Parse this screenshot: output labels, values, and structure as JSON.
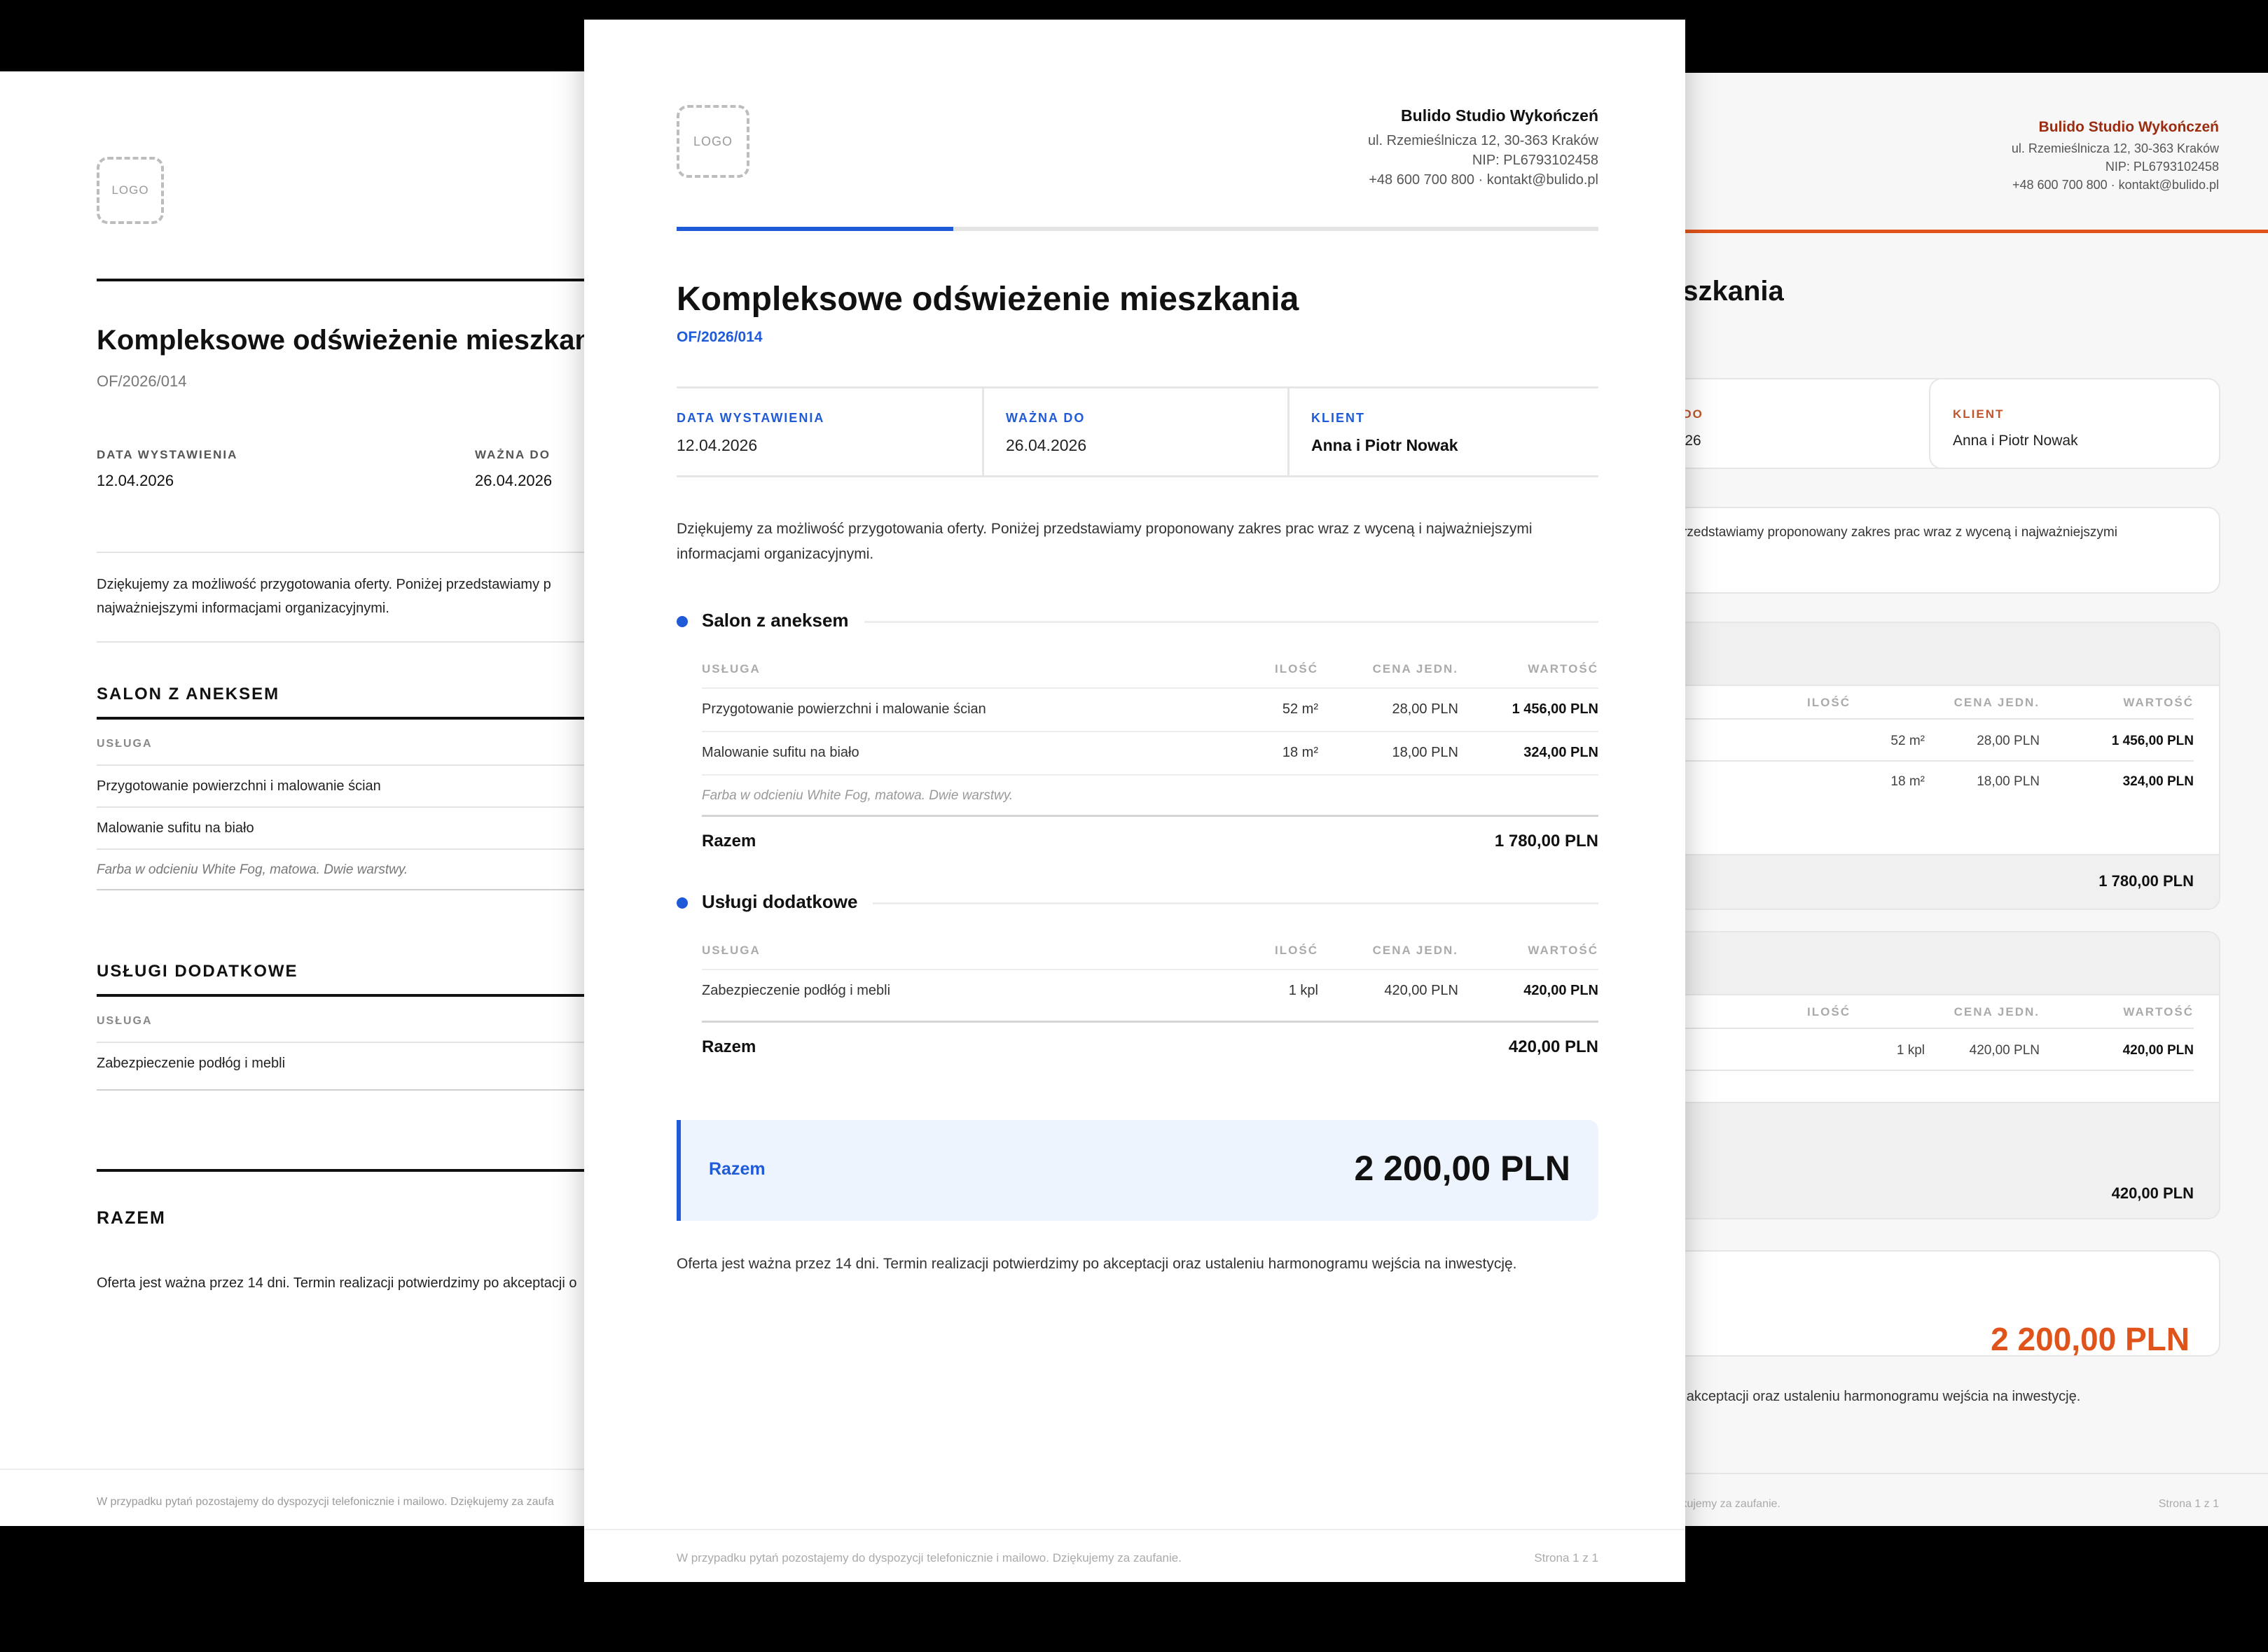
{
  "company": {
    "name": "Bulido Studio Wykończeń",
    "address": "ul. Rzemieślnicza 12, 30-363 Kraków",
    "nip": "NIP: PL6793102458",
    "contact": "+48 600 700 800 · kontakt@bulido.pl"
  },
  "logo_placeholder": "LOGO",
  "offer": {
    "title": "Kompleksowe odświeżenie mieszkania",
    "title_fragment_right": "eszkania",
    "number": "OF/2026/014",
    "issue_date_label_blue": "DATA WYSTAWIENIA",
    "issue_date_label_black": "DATA WYSTAWIENIA",
    "issue_date": "12.04.2026",
    "valid_until_label_blue": "WAŻNA DO",
    "valid_until_label_black": "WAŻNA DO",
    "valid_until_label_orange_fragment": "A DO",
    "valid_until": "26.04.2026",
    "valid_until_fragment": "2026",
    "client_label": "KLIENT",
    "client": "Anna i Piotr Nowak"
  },
  "intro": {
    "full": "Dziękujemy za możliwość przygotowania oferty. Poniżej przedstawiamy proponowany zakres prac wraz z wyceną i najważniejszymi informacjami organizacyjnymi.",
    "left_line1": "Dziękujemy za możliwość przygotowania oferty. Poniżej przedstawiamy p",
    "left_line2": "najważniejszymi informacjami organizacyjnymi.",
    "right_fragment": "j przedstawiamy proponowany zakres prac wraz z wyceną i najważniejszymi"
  },
  "table_headers": {
    "service": "USŁUGA",
    "qty": "ILOŚĆ",
    "unit_price": "CENA JEDN.",
    "value": "WARTOŚĆ"
  },
  "sections": {
    "salon": {
      "title": "Salon z aneksem",
      "title_caps": "SALON Z ANEKSEM",
      "rows": [
        {
          "service": "Przygotowanie powierzchni i malowanie ścian",
          "qty": "52 m²",
          "unit_price": "28,00 PLN",
          "value": "1 456,00 PLN"
        },
        {
          "service": "Malowanie sufitu na biało",
          "qty": "18 m²",
          "unit_price": "18,00 PLN",
          "value": "324,00 PLN"
        }
      ],
      "note": "Farba w odcieniu White Fog, matowa. Dwie warstwy.",
      "subtotal_label": "Razem",
      "subtotal": "1 780,00 PLN"
    },
    "extra": {
      "title": "Usługi dodatkowe",
      "title_caps": "USŁUGI DODATKOWE",
      "rows": [
        {
          "service": "Zabezpieczenie podłóg i mebli",
          "qty": "1 kpl",
          "unit_price": "420,00 PLN",
          "value": "420,00 PLN"
        }
      ],
      "subtotal_label": "Razem",
      "subtotal": "420,00 PLN"
    }
  },
  "total": {
    "label": "Razem",
    "label_caps": "RAZEM",
    "value": "2 200,00 PLN"
  },
  "validity": {
    "full": "Oferta jest ważna przez 14 dni. Termin realizacji potwierdzimy po akceptacji oraz ustaleniu harmonogramu wejścia na inwestycję.",
    "left_fragment": "Oferta jest ważna przez 14 dni. Termin realizacji potwierdzimy po akceptacji o",
    "right_fragment": "po akceptacji oraz ustaleniu harmonogramu wejścia na inwestycję."
  },
  "footer": {
    "text": "W przypadku pytań pozostajemy do dyspozycji telefonicznie i mailowo. Dziękujemy za zaufanie.",
    "left_fragment": "W przypadku pytań pozostajemy do dyspozycji telefonicznie i mailowo. Dziękujemy za zaufa",
    "right_fragment": "ziękujemy za zaufanie.",
    "page": "Strona 1 z 1"
  },
  "colors": {
    "blue_accent": "#1f5bd8",
    "orange_accent": "#e0531b",
    "total_box_bg": "#eef4fe"
  },
  "progress": {
    "fraction": 0.3
  }
}
